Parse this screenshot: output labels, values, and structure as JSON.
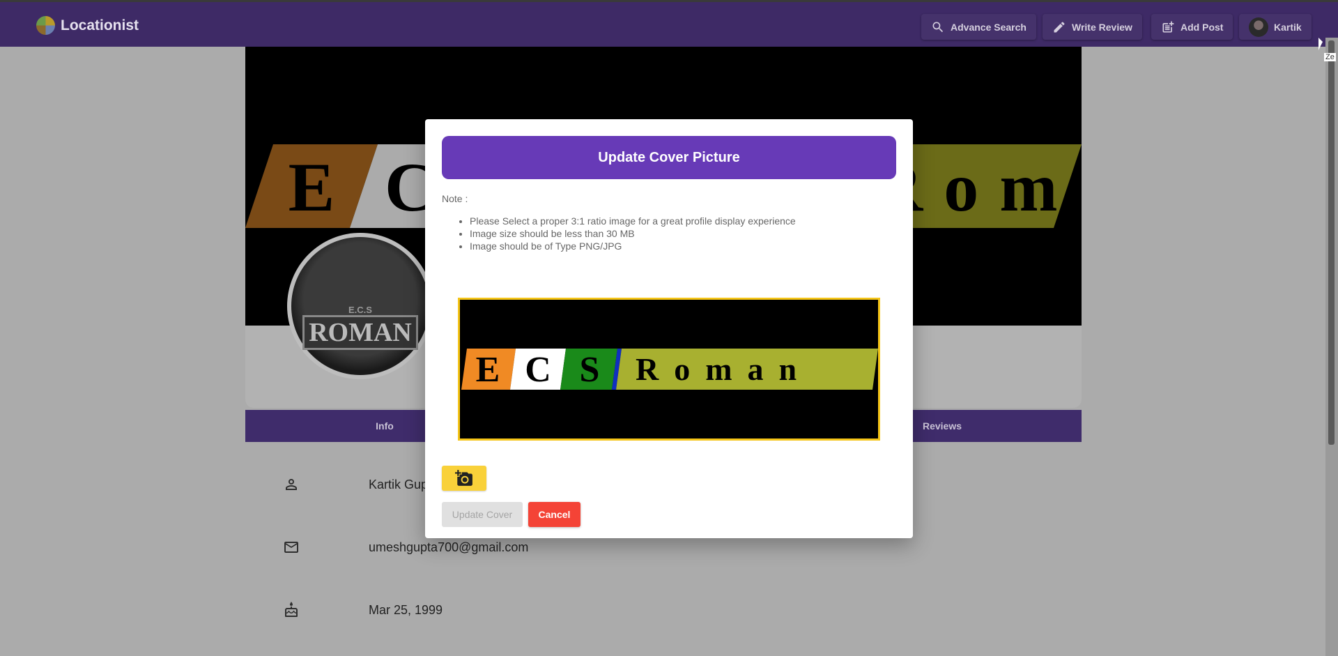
{
  "app": {
    "name": "Locationist"
  },
  "nav": {
    "advance_search": "Advance Search",
    "write_review": "Write Review",
    "add_post": "Add Post",
    "user": "Kartik"
  },
  "profile": {
    "tabs": [
      "Info",
      "Reviews"
    ],
    "name": "Kartik Gup",
    "email": "umeshgupta700@gmail.com",
    "birthday": "Mar 25, 1999",
    "cover_letters": [
      "E",
      "C",
      "S",
      "Roman"
    ],
    "avatar_text": {
      "top": "E.C.S",
      "bottom": "ROMAN"
    }
  },
  "modal": {
    "title": "Update Cover Picture",
    "note_label": "Note :",
    "notes": [
      "Please Select a proper 3:1 ratio image for a great profile display experience",
      "Image size should be less than 30 MB",
      "Image should be of Type PNG/JPG"
    ],
    "update_button": "Update Cover",
    "cancel_button": "Cancel"
  },
  "tooltip": "Ze",
  "icons": {
    "search": "search-icon",
    "pencil": "pencil-icon",
    "add_post": "post-add-icon",
    "person": "person-icon",
    "mail": "mail-icon",
    "cake": "cake-icon",
    "camera": "add-camera-icon"
  },
  "colors": {
    "primary": "#673ab7",
    "cancel": "#f44336",
    "accent": "#f9d13a"
  }
}
